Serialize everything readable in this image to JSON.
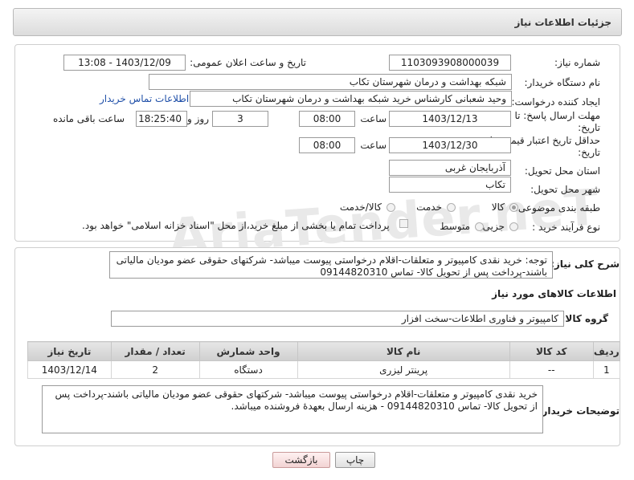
{
  "header": {
    "title": "جزئیات اطلاعات نیاز"
  },
  "form": {
    "need_number_label": "شماره نیاز:",
    "need_number": "1103093908000039",
    "announce_label": "تاریخ و ساعت اعلان عمومی:",
    "announce_value": "1403/12/09 - 13:08",
    "buyer_org_label": "نام دستگاه خریدار:",
    "buyer_org": "شبکه بهداشت و درمان شهرستان تکاب",
    "creator_label": "ایجاد کننده درخواست:",
    "creator": "وحید شعبانی کارشناس خرید شبکه بهداشت و درمان شهرستان تکاب",
    "contact_link": "اطلاعات تماس خریدار",
    "reply_deadline_label": "مهلت ارسال پاسخ: تا تاریخ:",
    "reply_date": "1403/12/13",
    "time_label": "ساعت",
    "reply_time": "08:00",
    "days_value": "3",
    "days_label": "روز و",
    "remaining_time": "18:25:40",
    "remaining_label": "ساعت باقی مانده",
    "price_validity_label": "حداقل تاریخ اعتبار قیمت: تا تاریخ:",
    "price_date": "1403/12/30",
    "price_time": "08:00",
    "province_label": "استان محل تحویل:",
    "province": "آذربایجان غربی",
    "city_label": "شهر محل تحویل:",
    "city": "تکاب",
    "category_label": "طبقه بندی موضوعی:",
    "category_options": [
      "کالا",
      "خدمت",
      "کالا/خدمت"
    ],
    "process_label": "نوع فرآیند خرید :",
    "process_options": [
      "جزیی",
      "متوسط"
    ],
    "payment_note": "پرداخت تمام یا بخشی از مبلغ خرید،از محل \"اسناد خزانه اسلامی\" خواهد بود."
  },
  "details": {
    "summary_label": "شرح کلی نیاز:",
    "summary_text": "توجه: خرید نقدی کامپیوتر و متعلقات-اقلام درخواستی پیوست میباشد- شرکتهای حقوقی عضو مودیان مالیاتی باشند-پرداخت پس از تحویل کالا- تماس 09144820310",
    "goods_info_title": "اطلاعات کالاهای مورد نیاز",
    "goods_group_label": "گروه کالا:",
    "goods_group": "کامپیوتر و فناوری اطلاعات-سخت افزار",
    "table": {
      "headers": [
        "ردیف",
        "کد کالا",
        "نام کالا",
        "واحد شمارش",
        "تعداد / مقدار",
        "تاریخ نیاز"
      ],
      "rows": [
        [
          "1",
          "--",
          "پرینتر لیزری",
          "دستگاه",
          "2",
          "1403/12/14"
        ]
      ]
    },
    "buyer_notes_label": "توضیحات خریدار:",
    "buyer_notes": "خرید نقدی کامپیوتر و متعلقات-اقلام درخواستی پیوست میباشد- شرکتهای حقوقی عضو مودیان مالیاتی باشند-پرداخت پس از تحویل کالا- تماس 09144820310 - هزینه ارسال بعهدهٔ فروشنده میباشد."
  },
  "buttons": {
    "print": "چاپ",
    "back": "بازگشت"
  },
  "watermark": "AriaTender.neT"
}
